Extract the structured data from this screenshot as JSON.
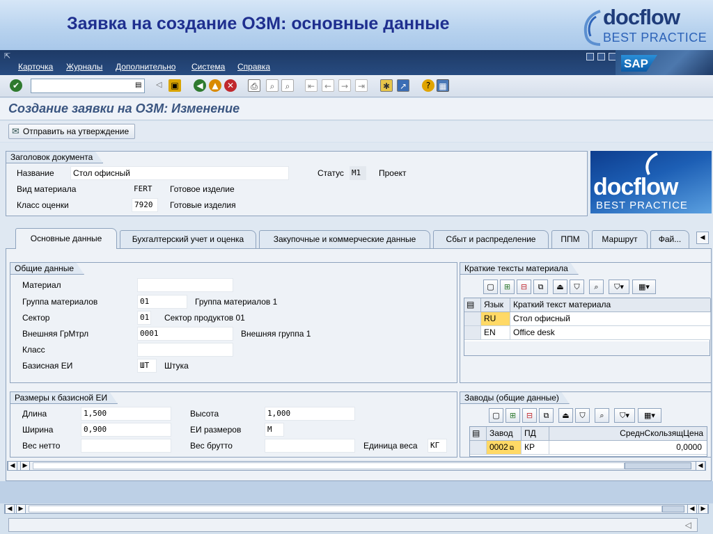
{
  "slide": {
    "title": "Заявка на создание ОЗМ: основные данные",
    "brand_top": "docflow",
    "brand_bottom": "BEST PRACTICE"
  },
  "menu": [
    "Карточка",
    "Журналы",
    "Дополнительно",
    "Система",
    "Справка"
  ],
  "sap_logo": "SAP",
  "toolbar": {
    "command_value": "",
    "icons": [
      "enter-icon",
      "save-icon",
      "back-icon",
      "exit-icon",
      "cancel-icon",
      "print-icon",
      "find-icon",
      "find-next-icon",
      "first-page-icon",
      "previous-page-icon",
      "next-page-icon",
      "last-page-icon",
      "create-session-icon",
      "shortcut-icon",
      "help-icon",
      "customize-layout-icon"
    ]
  },
  "screen_title": "Создание заявки на ОЗМ: Изменение",
  "app_toolbar": {
    "submit_label": "Отправить на утверждение"
  },
  "header_group": {
    "title": "Заголовок документа",
    "name_label": "Название",
    "name_value": "Стол офисный",
    "status_label": "Статус",
    "status_code": "M1",
    "status_text": "Проект",
    "mat_type_label": "Вид материала",
    "mat_type_code": "FERT",
    "mat_type_text": "Готовое изделие",
    "val_class_label": "Класс оценки",
    "val_class_code": "7920",
    "val_class_text": "Готовые изделия"
  },
  "side_image": {
    "top": "docflow",
    "bottom": "BEST PRACTICE"
  },
  "tabs": [
    {
      "label": "Основные данные",
      "active": true
    },
    {
      "label": "Бухгалтерский учет и оценка",
      "active": false
    },
    {
      "label": "Закупочные и коммерческие данные",
      "active": false
    },
    {
      "label": "Сбыт и распределение",
      "active": false
    },
    {
      "label": "ППМ",
      "active": false
    },
    {
      "label": "Маршрут",
      "active": false
    },
    {
      "label": "Фай...",
      "active": false
    }
  ],
  "general": {
    "title": "Общие данные",
    "material_label": "Материал",
    "material_value": "",
    "group_label": "Группа материалов",
    "group_code": "01",
    "group_text": "Группа материалов 1",
    "sector_label": "Сектор",
    "sector_code": "01",
    "sector_text": "Сектор продуктов 01",
    "ext_group_label": "Внешняя ГрМтрл",
    "ext_group_code": "0001",
    "ext_group_text": "Внешняя группа 1",
    "class_label": "Класс",
    "class_value": "",
    "base_uom_label": "Базисная ЕИ",
    "base_uom_code": "ШТ",
    "base_uom_text": "Штука"
  },
  "short_texts": {
    "title": "Краткие тексты материала",
    "col_lang": "Язык",
    "col_text": "Краткий текст материала",
    "rows": [
      {
        "lang": "RU",
        "text": "Стол офисный"
      },
      {
        "lang": "EN",
        "text": "Office desk"
      }
    ]
  },
  "dimensions": {
    "title": "Размеры к базисной ЕИ",
    "length_label": "Длина",
    "length_value": "1,500",
    "width_label": "Ширина",
    "width_value": "0,900",
    "net_label": "Вес нетто",
    "net_value": "",
    "height_label": "Высота",
    "height_value": "1,000",
    "dim_uom_label": "ЕИ размеров",
    "dim_uom_value": "М",
    "gross_label": "Вес брутто",
    "gross_value": "",
    "weight_unit_label": "Единица веса",
    "weight_unit_value": "КГ"
  },
  "plants": {
    "title": "Заводы (общие данные)",
    "col_plant": "Завод",
    "col_pd": "ПД",
    "col_price": "СреднСкользящЦена",
    "rows": [
      {
        "plant": "0002",
        "pd": "КР",
        "price": "0,0000"
      }
    ]
  },
  "colors": {
    "menubar": "#1e3a66",
    "title": "#3a5580",
    "slide_title": "#1f2f8f",
    "selected": "#ffd966"
  }
}
